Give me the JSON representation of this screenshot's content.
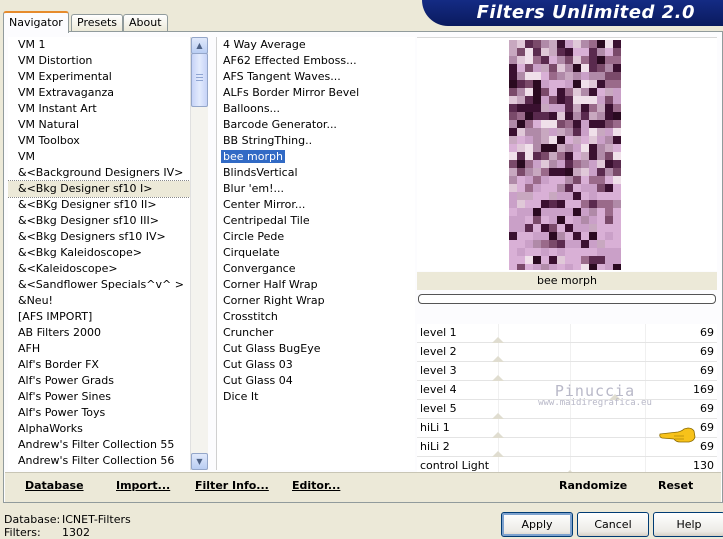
{
  "tabs": [
    {
      "label": "Navigator",
      "active": true
    },
    {
      "label": "Presets",
      "active": false
    },
    {
      "label": "About",
      "active": false
    }
  ],
  "banner_title": "Filters Unlimited 2.0",
  "categories": [
    "VM 1",
    "VM Distortion",
    "VM Experimental",
    "VM Extravaganza",
    "VM Instant Art",
    "VM Natural",
    "VM Toolbox",
    "VM",
    "&<Background Designers IV>",
    "&<Bkg Designer sf10 I>",
    "&<BKg Designer sf10 II>",
    "&<Bkg Designer sf10 III>",
    "&<Bkg Designers sf10 IV>",
    "&<Bkg Kaleidoscope>",
    "&<Kaleidoscope>",
    "&<Sandflower Specials^v^ >",
    "&Neu!",
    "[AFS IMPORT]",
    "AB Filters 2000",
    "AFH",
    "Alf's Border FX",
    "Alf's Power Grads",
    "Alf's Power Sines",
    "Alf's Power Toys",
    "AlphaWorks",
    "Andrew's Filter Collection 55",
    "Andrew's Filter Collection 56"
  ],
  "selected_category_index": 9,
  "filters": [
    "4 Way Average",
    "AF62 Effected Emboss...",
    "AFS Tangent Waves...",
    "ALFs Border Mirror Bevel",
    "Balloons...",
    "Barcode Generator...",
    "BB StringThing..",
    "bee morph",
    "BlindsVertical",
    "Blur 'em!...",
    "Center Mirror...",
    "Centripedal Tile",
    "Circle Pede",
    "Cirquelate",
    "Convergance",
    "Corner Half Wrap",
    "Corner Right Wrap",
    "Crosstitch",
    "Cruncher",
    "Cut Glass  BugEye",
    "Cut Glass 03",
    "Cut Glass 04",
    "Dice It"
  ],
  "selected_filter_index": 7,
  "preview_name": "bee morph",
  "sliders": [
    {
      "label": "level 1",
      "value": "69",
      "fraction": 0.27
    },
    {
      "label": "level 2",
      "value": "69",
      "fraction": 0.27
    },
    {
      "label": "level 3",
      "value": "69",
      "fraction": 0.27
    },
    {
      "label": "level 4",
      "value": "169",
      "fraction": 0.66
    },
    {
      "label": "level 5",
      "value": "69",
      "fraction": 0.27
    },
    {
      "label": "hiLi 1",
      "value": "69",
      "fraction": 0.27
    },
    {
      "label": "hiLi 2",
      "value": "69",
      "fraction": 0.27
    },
    {
      "label": "control Light",
      "value": "130",
      "fraction": 0.51
    }
  ],
  "watermark": {
    "line1": "Pinuccia",
    "line2": "www.maidiregrafica.eu"
  },
  "toolbar": {
    "database": "Database",
    "import": "Import...",
    "filter_info": "Filter Info...",
    "editor": "Editor...",
    "randomize": "Randomize",
    "reset": "Reset"
  },
  "footer": {
    "database_label": "Database:",
    "database_value": "ICNET-Filters",
    "filters_label": "Filters:",
    "filters_value": "1302"
  },
  "buttons": {
    "apply": "Apply",
    "cancel": "Cancel",
    "help": "Help"
  },
  "colors": {
    "selection": "#316ac5",
    "banner": "#142b84"
  }
}
